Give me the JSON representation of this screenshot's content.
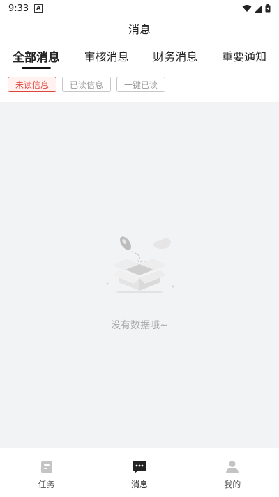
{
  "status_bar": {
    "time": "9:33",
    "indicator": "A"
  },
  "header": {
    "title": "消息"
  },
  "tabs": [
    {
      "label": "全部消息",
      "active": true
    },
    {
      "label": "审核消息",
      "active": false
    },
    {
      "label": "财务消息",
      "active": false
    },
    {
      "label": "重要通知",
      "active": false
    }
  ],
  "filters": [
    {
      "label": "未读信息",
      "active": true
    },
    {
      "label": "已读信息",
      "active": false
    },
    {
      "label": "一键已读",
      "active": false
    }
  ],
  "empty_state": {
    "text": "没有数据哦~"
  },
  "bottom_nav": [
    {
      "label": "任务",
      "icon": "task-icon",
      "active": false
    },
    {
      "label": "消息",
      "icon": "message-icon",
      "active": true
    },
    {
      "label": "我的",
      "icon": "profile-icon",
      "active": false
    }
  ],
  "colors": {
    "accent": "#e0453c",
    "background": "#f2f3f5"
  }
}
